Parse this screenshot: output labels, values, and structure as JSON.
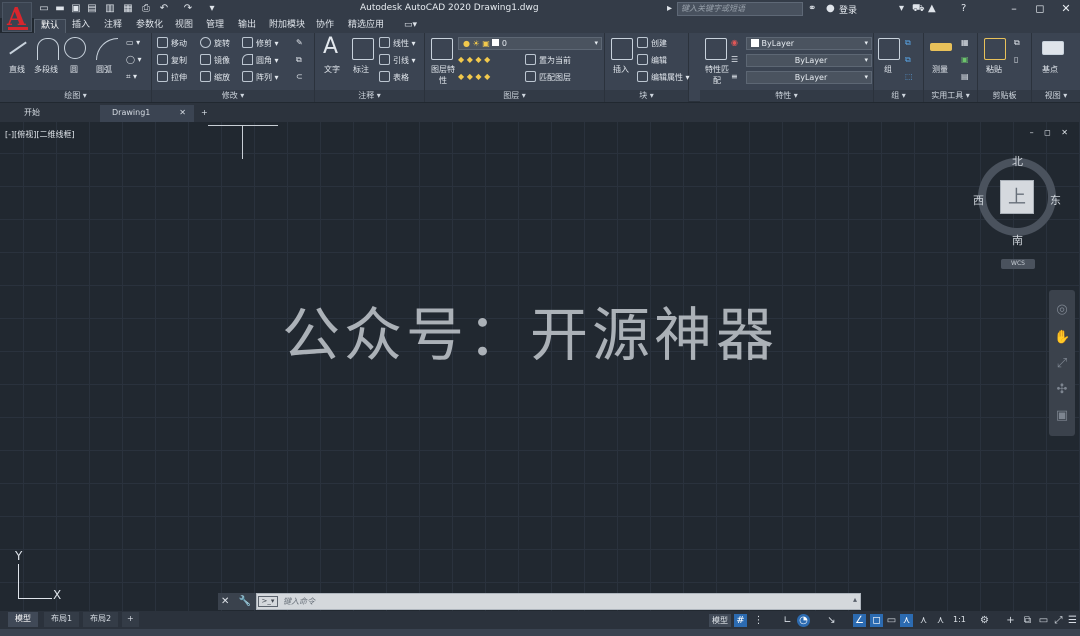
{
  "app": {
    "logo_letter": "A",
    "window_title": "Autodesk AutoCAD 2020    Drawing1.dwg",
    "search_placeholder": "键入关键字或短语",
    "login_label": "登录"
  },
  "ribbon_tabs": [
    "默认",
    "插入",
    "注释",
    "参数化",
    "视图",
    "管理",
    "输出",
    "附加模块",
    "协作",
    "精选应用"
  ],
  "panels": {
    "draw": {
      "title": "绘图",
      "tools": [
        "直线",
        "多段线",
        "圆",
        "圆弧"
      ]
    },
    "modify": {
      "title": "修改",
      "tools": [
        "移动",
        "旋转",
        "修剪",
        "复制",
        "镜像",
        "圆角",
        "拉伸",
        "缩放",
        "阵列"
      ]
    },
    "annotation": {
      "title": "注释",
      "tools": [
        "文字",
        "标注",
        "线性",
        "引线",
        "表格"
      ]
    },
    "layers": {
      "title": "图层",
      "tools": [
        "图层特性",
        "置为当前",
        "匹配图层"
      ],
      "current_layer": "0"
    },
    "block": {
      "title": "块",
      "tools": [
        "插入",
        "创建",
        "编辑",
        "编辑属性"
      ]
    },
    "properties": {
      "title": "特性",
      "match_label": "特性匹配",
      "color": "ByLayer",
      "linetype": "ByLayer",
      "lineweight": "ByLayer"
    },
    "group": {
      "title": "组",
      "tool": "组"
    },
    "utilities": {
      "title": "实用工具",
      "tool": "测量"
    },
    "clipboard": {
      "title": "剪贴板",
      "tool": "粘贴"
    },
    "view": {
      "title": "视图",
      "tool": "基点"
    }
  },
  "file_tabs": [
    "开始",
    "Drawing1"
  ],
  "canvas": {
    "view_label": "[-][俯视][二维线框]",
    "viewport_ctrls": "–  ◻  ✕",
    "watermark": "公众号：开源神器"
  },
  "viewcube": {
    "face": "上",
    "north": "北",
    "south": "南",
    "east": "东",
    "west": "西",
    "wcs": "WCS"
  },
  "ucs": {
    "x": "X",
    "y": "Y"
  },
  "command": {
    "placeholder": "键入命令"
  },
  "layout_tabs": [
    "模型",
    "布局1",
    "布局2"
  ],
  "status": {
    "model": "模型",
    "scale": "1:1"
  },
  "icons": {
    "accent_blue": "#2c6bb1",
    "logo_red": "#d9262d"
  }
}
